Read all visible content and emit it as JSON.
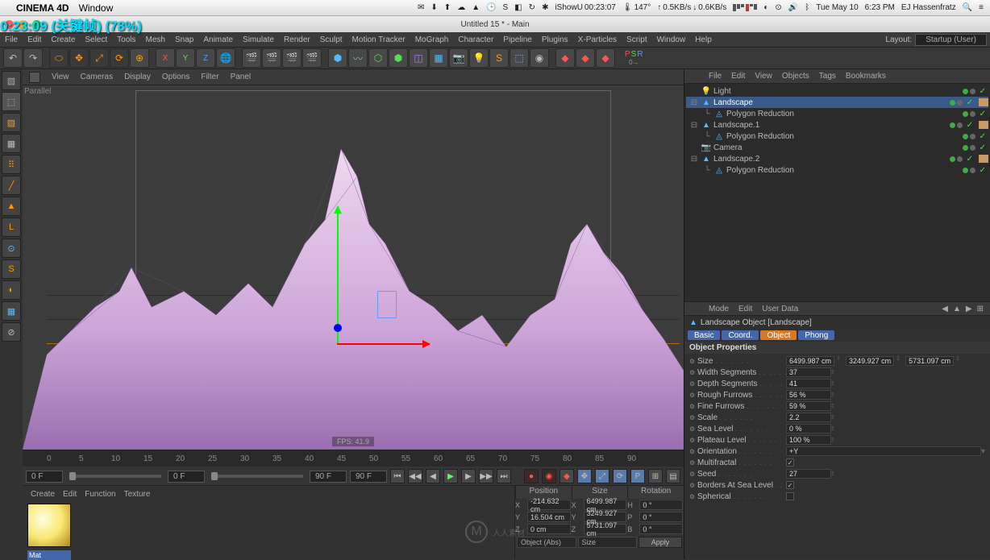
{
  "mac": {
    "app": "CINEMA 4D",
    "menu": [
      "Window"
    ],
    "temp": "147°",
    "netUp": "0.5KB/s",
    "netDn": "0.6KB/s",
    "timer": "00:23:07",
    "day": "Tue May 10",
    "time": "6:23 PM",
    "user": "EJ Hassenfratz"
  },
  "overlay": {
    "tc": "0:23:09 (关键帧) (78%)"
  },
  "window": {
    "title": "Untitled 15 * - Main"
  },
  "c4d_menu": [
    "File",
    "Edit",
    "Create",
    "Select",
    "Tools",
    "Mesh",
    "Snap",
    "Animate",
    "Simulate",
    "Render",
    "Sculpt",
    "Motion Tracker",
    "MoGraph",
    "Character",
    "Pipeline",
    "Plugins",
    "X-Particles",
    "Script",
    "Window",
    "Help"
  ],
  "layout": {
    "labelLayout": "Layout:",
    "value": "Startup (User)"
  },
  "psr": {
    "P": "P",
    "S": "S",
    "R": "R",
    "zero": "0→",
    "sub": "¬ ×"
  },
  "viewport": {
    "menus": [
      "View",
      "Cameras",
      "Display",
      "Options",
      "Filter",
      "Panel"
    ],
    "label": "Parallel",
    "fps": "FPS: 41.9"
  },
  "timeline": {
    "ticks": [
      "0",
      "5",
      "10",
      "15",
      "20",
      "25",
      "30",
      "35",
      "40",
      "45",
      "50",
      "55",
      "60",
      "65",
      "70",
      "75",
      "80",
      "85",
      "90"
    ],
    "startFrame": "0 F",
    "curFrame": "0 F",
    "endFrame": "90 F",
    "endFrame2": "90 F"
  },
  "material": {
    "menus": [
      "Create",
      "Edit",
      "Function",
      "Texture"
    ],
    "name": "Mat"
  },
  "coords": {
    "headers": [
      "Position",
      "Size",
      "Rotation"
    ],
    "rows": [
      {
        "axis": "X",
        "pos": "-214.632 cm",
        "size": "6499.987 cm",
        "rotA": "H",
        "rot": "0 °"
      },
      {
        "axis": "Y",
        "pos": "16.504 cm",
        "size": "3249.927 cm",
        "rotA": "P",
        "rot": "0 °"
      },
      {
        "axis": "Z",
        "pos": "0 cm",
        "size": "5731.097 cm",
        "rotA": "B",
        "rot": "0 °"
      }
    ],
    "mode": "Object (Abs)",
    "sizeMode": "Size",
    "apply": "Apply"
  },
  "om": {
    "menus": [
      "File",
      "Edit",
      "View",
      "Objects",
      "Tags",
      "Bookmarks"
    ],
    "items": [
      {
        "name": "Light",
        "icon": "light",
        "indent": 0,
        "sel": false,
        "tag": false
      },
      {
        "name": "Landscape",
        "icon": "landscape",
        "indent": 0,
        "sel": true,
        "tag": true,
        "exp": true
      },
      {
        "name": "Polygon Reduction",
        "icon": "poly",
        "indent": 1,
        "sel": false,
        "tag": false
      },
      {
        "name": "Landscape.1",
        "icon": "landscape",
        "indent": 0,
        "sel": false,
        "tag": true,
        "exp": true
      },
      {
        "name": "Polygon Reduction",
        "icon": "poly",
        "indent": 1,
        "sel": false,
        "tag": false
      },
      {
        "name": "Camera",
        "icon": "camera",
        "indent": 0,
        "sel": false,
        "tag": false
      },
      {
        "name": "Landscape.2",
        "icon": "landscape",
        "indent": 0,
        "sel": false,
        "tag": true,
        "exp": true
      },
      {
        "name": "Polygon Reduction",
        "icon": "poly",
        "indent": 1,
        "sel": false,
        "tag": false
      }
    ]
  },
  "am": {
    "menus": [
      "Mode",
      "Edit",
      "User Data"
    ],
    "title": "Landscape Object [Landscape]",
    "tabs": [
      "Basic",
      "Coord.",
      "Object",
      "Phong"
    ],
    "activeTab": 2,
    "section": "Object Properties",
    "props": [
      {
        "label": "Size",
        "type": "vec3",
        "v": [
          "6499.987 cm",
          "3249.927 cm",
          "5731.097 cm"
        ]
      },
      {
        "label": "Width Segments",
        "type": "num",
        "v": "37"
      },
      {
        "label": "Depth Segments",
        "type": "num",
        "v": "41"
      },
      {
        "label": "Rough Furrows",
        "type": "num",
        "v": "56 %"
      },
      {
        "label": "Fine Furrows",
        "type": "num",
        "v": "59 %"
      },
      {
        "label": "Scale",
        "type": "num",
        "v": "2.2"
      },
      {
        "label": "Sea Level",
        "type": "num",
        "v": "0 %"
      },
      {
        "label": "Plateau Level",
        "type": "num",
        "v": "100 %"
      },
      {
        "label": "Orientation",
        "type": "sel",
        "v": "+Y"
      },
      {
        "label": "Multifractal",
        "type": "chk",
        "v": true
      },
      {
        "label": "Seed",
        "type": "num",
        "v": "27"
      },
      {
        "label": "Borders At Sea Level",
        "type": "chk",
        "v": true
      },
      {
        "label": "Spherical",
        "type": "chk",
        "v": false
      }
    ]
  },
  "watermark": "人人素材"
}
